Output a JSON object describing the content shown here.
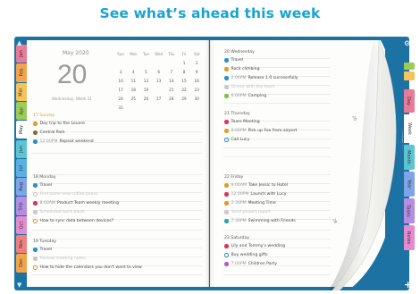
{
  "headline": "See what’s ahead this week",
  "colors": {
    "accent": "#19a3d3",
    "frame": "#1c72a2",
    "selected_day": "#2c8fc5"
  },
  "left_tabs": [
    {
      "label": "Jan",
      "color": "#e87b9a"
    },
    {
      "label": "Feb",
      "color": "#f3a54b"
    },
    {
      "label": "Mar",
      "color": "#f4c35a"
    },
    {
      "label": "Apr",
      "color": "#9ecb57"
    },
    {
      "label": "May",
      "color": "#ffffff"
    },
    {
      "label": "Jun",
      "color": "#5cc5d4"
    },
    {
      "label": "Jul",
      "color": "#5ab0e3"
    },
    {
      "label": "Aug",
      "color": "#7ea5e8"
    },
    {
      "label": "Sep",
      "color": "#b58de2"
    },
    {
      "label": "Oct",
      "color": "#e48bd0"
    },
    {
      "label": "Nov",
      "color": "#f07f7f"
    },
    {
      "label": "Dec",
      "color": "#f3a54b"
    }
  ],
  "right_tabs": [
    {
      "label": "",
      "color": "#9ecb57"
    },
    {
      "label": "",
      "color": "#f4c35a"
    },
    {
      "label": "Day",
      "color": "#e87b9a"
    },
    {
      "label": "Week",
      "color": "#ffffff"
    },
    {
      "label": "Month",
      "color": "#5cc5d4"
    },
    {
      "label": "Year",
      "color": "#7ea5e8"
    },
    {
      "label": "Tasks",
      "color": "#b58de2"
    },
    {
      "label": "Notes",
      "color": "#e48bd0"
    }
  ],
  "month": {
    "name": "May 2020",
    "big_day": "20",
    "weekday_line": "Wednesday, Week 21",
    "headers": [
      "Sun",
      "Mon",
      "Tue",
      "Wed",
      "Thu",
      "Fri",
      "Sat"
    ],
    "rows": [
      [
        "",
        "",
        "",
        "",
        "",
        "1",
        "2"
      ],
      [
        "3",
        "4",
        "5",
        "6",
        "7",
        "8",
        "9"
      ],
      [
        "10",
        "11",
        "12",
        "13",
        "14",
        "15",
        "16"
      ],
      [
        "17",
        "18",
        "19",
        "20",
        "21",
        "22",
        "23"
      ],
      [
        "24",
        "25",
        "26",
        "27",
        "28",
        "29",
        "30"
      ],
      [
        "31",
        "",
        "",
        "",
        "",
        "",
        ""
      ]
    ],
    "selected": "20"
  },
  "days": {
    "sun17": {
      "label": "17 Sunday",
      "events": [
        {
          "time": "",
          "title": "Day trip to the Louvre",
          "color": "#e09b2d",
          "ring": false
        },
        {
          "time": "",
          "title": "Central Park",
          "color": "#8a6d3b",
          "ring": false
        },
        {
          "time": "12:00PM",
          "title": "Repeat weekend",
          "color": "#2c8fc5",
          "ring": false
        }
      ]
    },
    "mon18": {
      "label": "18 Monday",
      "events": [
        {
          "time": "",
          "title": "Travel",
          "color": "#2c8fc5",
          "ring": false
        },
        {
          "time": "",
          "title": "Find some new coffee beans",
          "color": "#c9c9c9",
          "ring": true
        },
        {
          "time": "8:00AM",
          "title": "Product Team weekly meeting",
          "color": "#d9345d",
          "ring": false
        },
        {
          "time": "",
          "title": "Scheduled work block",
          "color": "#c9c9c9",
          "ring": false
        },
        {
          "time": "",
          "title": "How to sync data between devices?",
          "color": "#e09b2d",
          "ring": true
        }
      ]
    },
    "tue19": {
      "label": "19 Tuesday",
      "events": [
        {
          "time": "",
          "title": "Travel",
          "color": "#2c8fc5",
          "ring": false
        },
        {
          "time": "",
          "title": "Review meeting notes",
          "color": "#c9c9c9",
          "ring": false
        },
        {
          "time": "",
          "title": "How to hide the calendars you don't want to view",
          "color": "#e09b2d",
          "ring": true
        }
      ]
    },
    "wed20": {
      "label": "20 Wednesday",
      "events": [
        {
          "time": "",
          "title": "Travel",
          "color": "#2c8fc5",
          "ring": false
        },
        {
          "time": "",
          "title": "Rock climbing",
          "color": "#e09b2d",
          "ring": false
        },
        {
          "time": "2:00PM",
          "title": "Release 1.0 successfully",
          "color": "#2c8fc5",
          "ring": false
        },
        {
          "time": "",
          "title": "Dinner with the team",
          "color": "#c9c9c9",
          "ring": false
        },
        {
          "time": "6:00PM",
          "title": "Camping",
          "color": "#7fbf3f",
          "ring": false
        }
      ]
    },
    "thu21": {
      "label": "21 Thursday",
      "events": [
        {
          "time": "",
          "title": "Team Meeting",
          "color": "#d9345d",
          "ring": false
        },
        {
          "time": "8:00PM",
          "title": "Pick up Fox from airport",
          "color": "#e09b2d",
          "ring": false
        },
        {
          "time": "",
          "title": "Call Lucy",
          "color": "#2c8fc5",
          "ring": true
        }
      ]
    },
    "fri22": {
      "label": "22 Friday",
      "events": [
        {
          "time": "9:00AM",
          "title": "Take Jessic to Hotel",
          "color": "#e09b2d",
          "ring": false
        },
        {
          "time": "12:00PM",
          "title": "Launch with Lucy",
          "color": "#d9345d",
          "ring": false
        },
        {
          "time": "2:30PM",
          "title": "Meeting Time",
          "color": "#e09b2d",
          "ring": false
        },
        {
          "time": "",
          "title": "Send project report",
          "color": "#c9c9c9",
          "ring": false
        },
        {
          "time": "7:30PM",
          "title": "Swimming with Friends",
          "color": "#2aa7a0",
          "ring": false
        }
      ]
    },
    "sat23": {
      "label": "23 Saturday",
      "events": [
        {
          "time": "",
          "title": "Lily and Tommy's wedding",
          "color": "#d9345d",
          "ring": false
        },
        {
          "time": "",
          "title": "Buy wedding gifts",
          "color": "#2c8fc5",
          "ring": true
        },
        {
          "time": "7:00PM",
          "title": "Children Party",
          "color": "#b45cc9",
          "ring": false
        }
      ]
    }
  }
}
